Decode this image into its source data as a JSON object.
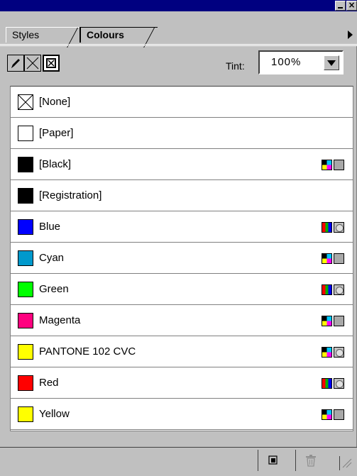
{
  "tabs": [
    {
      "label": "Styles",
      "active": false
    },
    {
      "label": "Colours",
      "active": true
    }
  ],
  "toolbar": {
    "tint_label": "Tint:",
    "tint_value": "100%"
  },
  "swatches": [
    {
      "name": "[None]",
      "color": "none",
      "model": "",
      "type": ""
    },
    {
      "name": "[Paper]",
      "color": "#ffffff",
      "model": "",
      "type": ""
    },
    {
      "name": "[Black]",
      "color": "#000000",
      "model": "cmyk",
      "type": "process"
    },
    {
      "name": "[Registration]",
      "color": "#000000",
      "model": "",
      "type": ""
    },
    {
      "name": "Blue",
      "color": "#0000ff",
      "model": "rgb",
      "type": "spot"
    },
    {
      "name": "Cyan",
      "color": "#0099cc",
      "model": "cmyk",
      "type": "process"
    },
    {
      "name": "Green",
      "color": "#00ff00",
      "model": "rgb",
      "type": "spot"
    },
    {
      "name": "Magenta",
      "color": "#ff007f",
      "model": "cmyk",
      "type": "process"
    },
    {
      "name": "PANTONE 102 CVC",
      "color": "#ffff00",
      "model": "cmyk",
      "type": "spot"
    },
    {
      "name": "Red",
      "color": "#ff0000",
      "model": "rgb",
      "type": "spot"
    },
    {
      "name": "Yellow",
      "color": "#ffff00",
      "model": "cmyk",
      "type": "process"
    }
  ],
  "colors": {
    "titlebar": "#000080",
    "panel": "#c0c0c0"
  },
  "icons": {
    "tool_1": "pencil-icon",
    "tool_2": "no-color-icon",
    "tool_3": "fill-box-icon",
    "footer_1": "new-swatch-icon",
    "footer_2": "trash-icon"
  }
}
